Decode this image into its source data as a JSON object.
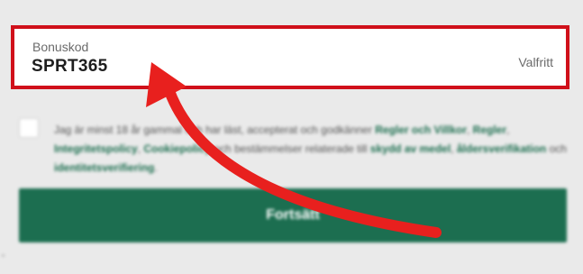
{
  "bonus": {
    "label": "Bonuskod",
    "value": "SPRT365",
    "optional": "Valfritt"
  },
  "consent": {
    "p1": "Jag är minst 18 år gammal och har läst, accepterat och godkänner ",
    "l1": "Regler och Villkor",
    "p2": ", ",
    "l2": "Regler",
    "p3": ", ",
    "l3": "Integritetspolicy",
    "p4": ", ",
    "l4": "Cookiepolicy",
    "p5": " och bestämmelser relaterade till ",
    "l5": "skydd av medel",
    "p6": ", ",
    "l6": "åldersverifikation",
    "p7": " och ",
    "l7": "identitetsverifiering",
    "p8": "."
  },
  "continue_label": "Fortsätt",
  "arrow_color": "#e8201e"
}
